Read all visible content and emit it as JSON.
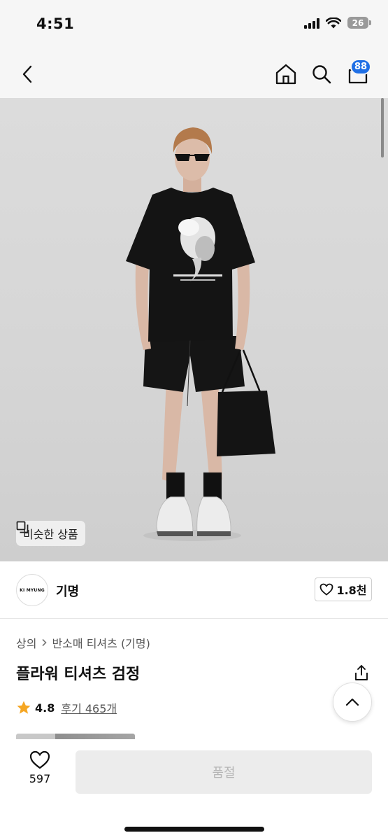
{
  "status_bar": {
    "time": "4:51",
    "battery": "26"
  },
  "nav": {
    "back_icon": "chevron-left-icon",
    "home_icon": "home-icon",
    "search_icon": "search-icon",
    "cart_icon": "cart-icon",
    "cart_badge": "88"
  },
  "hero": {
    "similar_products_label": "비슷한 상품",
    "similar_icon": "copy-icon"
  },
  "brand": {
    "logo_text": "KI MYUNG",
    "name": "기명",
    "likes": "1.8천"
  },
  "product": {
    "breadcrumb": [
      "상의",
      "반소매 티셔츠 (기명)"
    ],
    "title": "플라워 티셔츠 검정",
    "rating": "4.8",
    "reviews_label": "후기 465개"
  },
  "bottom_bar": {
    "wish_count": "597",
    "buy_label": "품절"
  },
  "colors": {
    "accent": "#1f6fe5",
    "star": "#f5a623"
  }
}
